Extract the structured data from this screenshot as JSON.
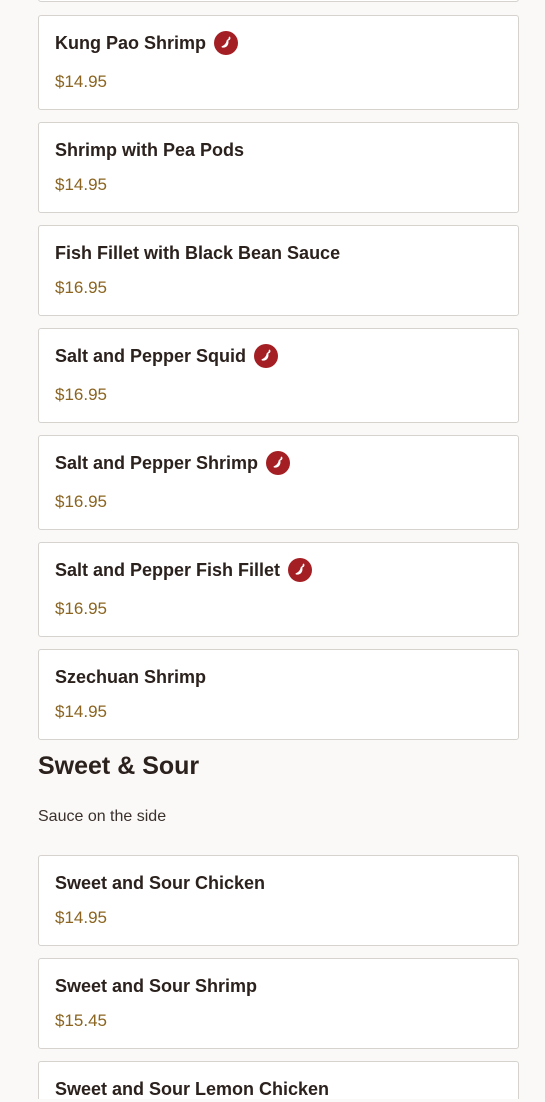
{
  "colors": {
    "background": "#faf9f7",
    "card_border": "#d6d3ce",
    "price": "#8a6420",
    "spicy_badge": "#a31f24",
    "text": "#2b211d"
  },
  "spicy_icon_name": "chili-pepper-icon",
  "items_seafood": [
    {
      "name": "Kung Pao Shrimp",
      "price": "$14.95",
      "spicy": true
    },
    {
      "name": "Shrimp with Pea Pods",
      "price": "$14.95",
      "spicy": false
    },
    {
      "name": "Fish Fillet with Black Bean Sauce",
      "price": "$16.95",
      "spicy": false
    },
    {
      "name": "Salt and Pepper Squid",
      "price": "$16.95",
      "spicy": true
    },
    {
      "name": "Salt and Pepper Shrimp",
      "price": "$16.95",
      "spicy": true
    },
    {
      "name": "Salt and Pepper Fish Fillet",
      "price": "$16.95",
      "spicy": true
    },
    {
      "name": "Szechuan Shrimp",
      "price": "$14.95",
      "spicy": false
    }
  ],
  "section_sweet_sour": {
    "title": "Sweet & Sour",
    "description": "Sauce on the side",
    "items": [
      {
        "name": "Sweet and Sour Chicken",
        "price": "$14.95",
        "spicy": false
      },
      {
        "name": "Sweet and Sour Shrimp",
        "price": "$15.45",
        "spicy": false
      },
      {
        "name": "Sweet and Sour Lemon Chicken",
        "price": "",
        "spicy": false
      }
    ]
  }
}
